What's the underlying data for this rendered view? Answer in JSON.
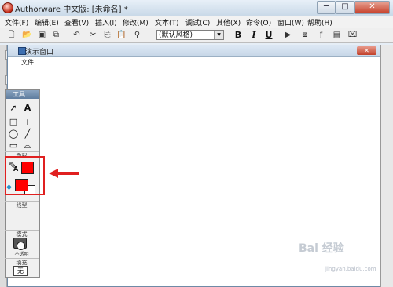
{
  "window": {
    "title": "Authorware 中文版: [未命名] *",
    "minimize": "─",
    "maximize": "□",
    "close": "✕"
  },
  "menu": [
    "文件(F)",
    "编辑(E)",
    "查看(V)",
    "插入(I)",
    "修改(M)",
    "文本(T)",
    "调试(C)",
    "其他(X)",
    "命令(O)",
    "窗口(W)",
    "帮助(H)"
  ],
  "toolbar": {
    "style_select": "(默认风格)",
    "bold": "B",
    "italic": "I",
    "underline": "U",
    "icons": [
      "new-icon",
      "open-icon",
      "save-icon",
      "import-icon",
      "undo-icon",
      "cut-icon",
      "copy-icon",
      "paste-icon",
      "find-icon",
      "run-icon",
      "control-panel-icon",
      "functions-icon",
      "variables-icon",
      "knowledge-objects-icon"
    ]
  },
  "presentation_window": {
    "title": "演示窗口",
    "menu_file": "文件"
  },
  "tools_palette": {
    "title": "工具",
    "tools": [
      "pointer-tool",
      "text-tool",
      "rectangle-tool",
      "cross-tool",
      "ellipse-tool",
      "line-tool",
      "rounded-rect-tool",
      "polygon-tool"
    ],
    "color_label": "色彩",
    "line_label": "线型",
    "mode_label": "模式",
    "mode_value": "不透明",
    "fill_label": "填充",
    "fill_value": "无",
    "colors": {
      "foreground": "#ff0000",
      "background": "#ff0000",
      "highlight": "#e02020"
    }
  },
  "watermark": {
    "text": "Bai 经验",
    "sub": "jingyan.baidu.com"
  }
}
